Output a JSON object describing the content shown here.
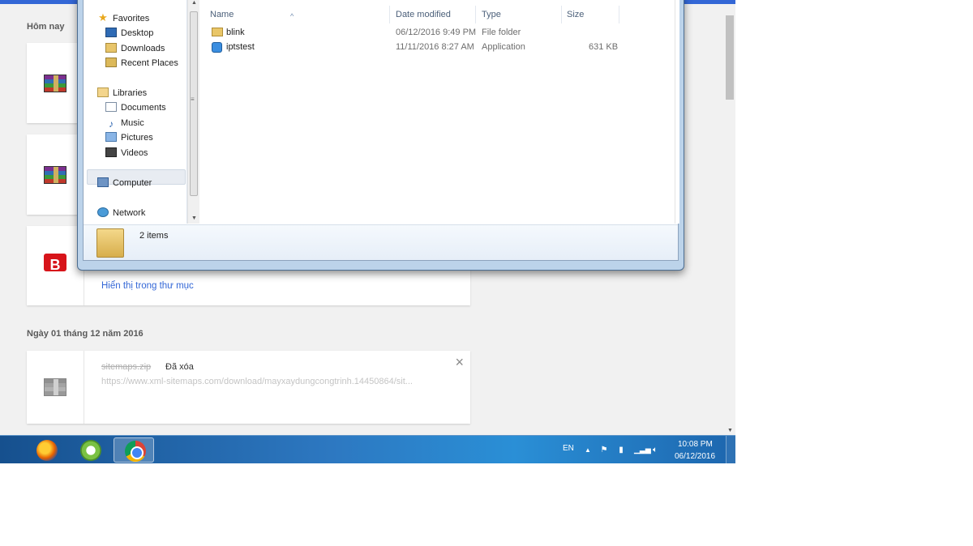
{
  "downloads": {
    "section_today": "Hôm nay",
    "show_in_folder": "Hiển thị trong thư mục",
    "section_date": "Ngày 01 tháng 12 năm 2016",
    "deleted_item": {
      "filename": "sitemaps.zip",
      "status": "Đã xóa",
      "url": "https://www.xml-sitemaps.com/download/mayxaydungcongtrinh.14450864/sit..."
    },
    "brand_letter": "B"
  },
  "explorer": {
    "nav": {
      "favorites": "Favorites",
      "desktop": "Desktop",
      "downloads": "Downloads",
      "recent_places": "Recent Places",
      "libraries": "Libraries",
      "documents": "Documents",
      "music": "Music",
      "pictures": "Pictures",
      "videos": "Videos",
      "computer": "Computer",
      "network": "Network"
    },
    "columns": {
      "name": "Name",
      "date_modified": "Date modified",
      "type": "Type",
      "size": "Size"
    },
    "files": [
      {
        "name": "blink",
        "date": "06/12/2016 9:49 PM",
        "type": "File folder",
        "size": ""
      },
      {
        "name": "iptstest",
        "date": "11/11/2016 8:27 AM",
        "type": "Application",
        "size": "631 KB"
      }
    ],
    "item_count": "2 items"
  },
  "taskbar": {
    "language": "EN",
    "time": "10:08 PM",
    "date": "06/12/2016"
  },
  "colors": {
    "link_blue": "#3367d6",
    "taskbar_blue": "#2d78c1",
    "brand_red": "#d7141a"
  }
}
